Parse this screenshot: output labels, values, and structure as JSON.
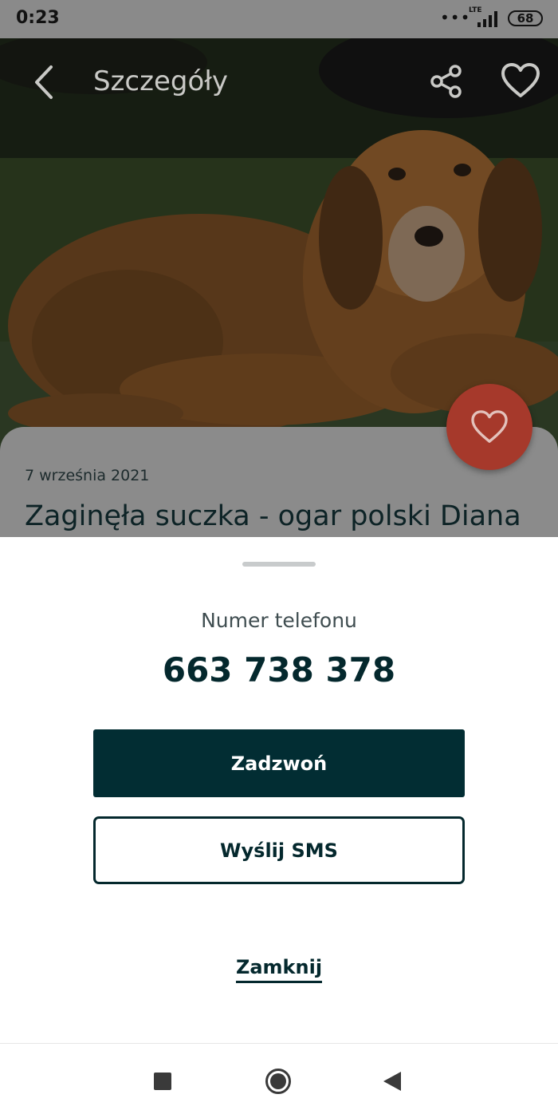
{
  "status_bar": {
    "time": "0:23",
    "network": "LTE",
    "battery": "68"
  },
  "toolbar": {
    "title": "Szczegóły"
  },
  "card": {
    "date": "7 września 2021",
    "title": "Zaginęła suczka - ogar polski Diana"
  },
  "sheet": {
    "label": "Numer telefonu",
    "phone": "663 738 378",
    "call_label": "Zadzwoń",
    "sms_label": "Wyślij SMS",
    "close_label": "Zamknij"
  },
  "colors": {
    "primary": "#022d33",
    "fab": "#a6392b"
  }
}
